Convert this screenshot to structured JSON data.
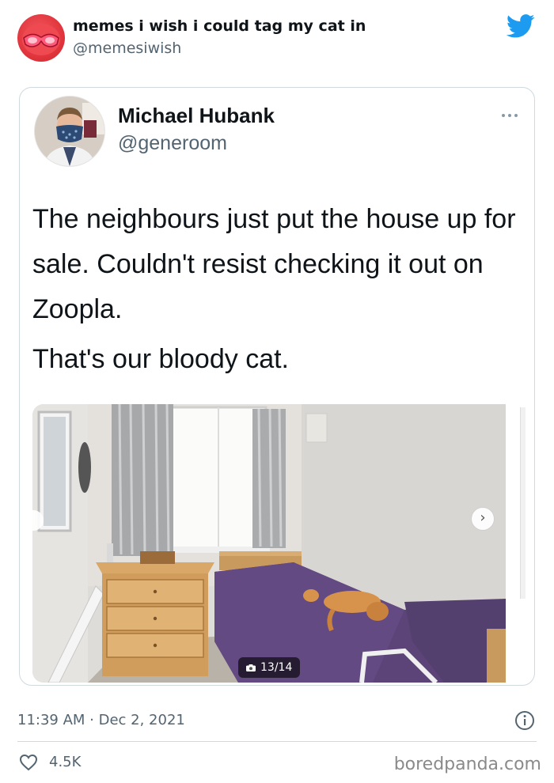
{
  "outer_tweet": {
    "display_name": "memes i wish i could tag my cat in",
    "handle": "@memesiwish",
    "avatar_icon": "red-sunglasses-avatar",
    "platform_icon": "twitter-bird-icon",
    "brand_color": "#1d9bf0"
  },
  "quoted_tweet": {
    "display_name": "Michael Hubank",
    "handle": "@generoom",
    "more_icon": "more-dots-icon",
    "text_paragraphs": [
      "The neighbours just put the house up for sale. Couldn't resist checking it out on Zoopla.",
      "That's our bloody cat."
    ],
    "media": {
      "description_icon": "bedroom-photo",
      "counter": "13/14",
      "next_icon": "chevron-right-icon"
    }
  },
  "footer": {
    "timestamp": "11:39 AM · Dec 2, 2021",
    "likes": "4.5K",
    "watermark": "boredpanda.com"
  }
}
